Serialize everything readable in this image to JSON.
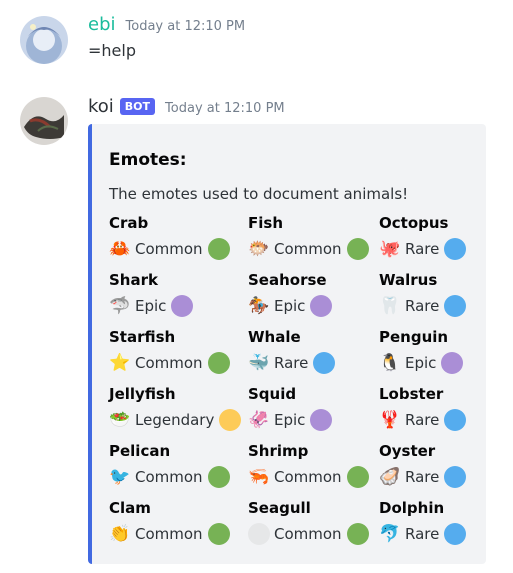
{
  "colors": {
    "common": "#77b255",
    "epic": "#aa8ed6",
    "rare": "#55acee",
    "legendary": "#fdcb58",
    "blank": "#e6e7e8",
    "embed_border": "#4169e1",
    "user_ebi": "#1abc9c",
    "user_koi": "#2e3338"
  },
  "messages": [
    {
      "username": "ebi",
      "timestamp": "Today at 12:10 PM",
      "content": "=help"
    },
    {
      "username": "koi",
      "bot_tag": "BOT",
      "timestamp": "Today at 12:10 PM"
    }
  ],
  "embed": {
    "title": "Emotes:",
    "description": "The emotes used to document animals!",
    "fields": [
      {
        "name": "Crab",
        "emoji": "🦀",
        "rarity": "Common",
        "level": "common"
      },
      {
        "name": "Fish",
        "emoji": "🐡",
        "rarity": "Common",
        "level": "common"
      },
      {
        "name": "Octopus",
        "emoji": "🐙",
        "rarity": "Rare",
        "level": "rare"
      },
      {
        "name": "Shark",
        "emoji": "🦈",
        "rarity": "Epic",
        "level": "epic"
      },
      {
        "name": "Seahorse",
        "emoji": "🏇",
        "rarity": "Epic",
        "level": "epic"
      },
      {
        "name": "Walrus",
        "emoji": "🦷",
        "rarity": "Rare",
        "level": "rare"
      },
      {
        "name": "Starfish",
        "emoji": "⭐",
        "rarity": "Common",
        "level": "common"
      },
      {
        "name": "Whale",
        "emoji": "🐳",
        "rarity": "Rare",
        "level": "rare"
      },
      {
        "name": "Penguin",
        "emoji": "🐧",
        "rarity": "Epic",
        "level": "epic"
      },
      {
        "name": "Jellyfish",
        "emoji": "🥗",
        "rarity": "Legendary",
        "level": "legendary"
      },
      {
        "name": "Squid",
        "emoji": "🦑",
        "rarity": "Epic",
        "level": "epic"
      },
      {
        "name": "Lobster",
        "emoji": "🦞",
        "rarity": "Rare",
        "level": "rare"
      },
      {
        "name": "Pelican",
        "emoji": "🐦",
        "rarity": "Common",
        "level": "common"
      },
      {
        "name": "Shrimp",
        "emoji": "🦐",
        "rarity": "Common",
        "level": "common"
      },
      {
        "name": "Oyster",
        "emoji": "🦪",
        "rarity": "Rare",
        "level": "rare"
      },
      {
        "name": "Clam",
        "emoji": "👏",
        "rarity": "Common",
        "level": "common"
      },
      {
        "name": "Seagull",
        "emoji": "",
        "rarity": "Common",
        "level": "common"
      },
      {
        "name": "Dolphin",
        "emoji": "🐬",
        "rarity": "Rare",
        "level": "rare"
      }
    ]
  }
}
